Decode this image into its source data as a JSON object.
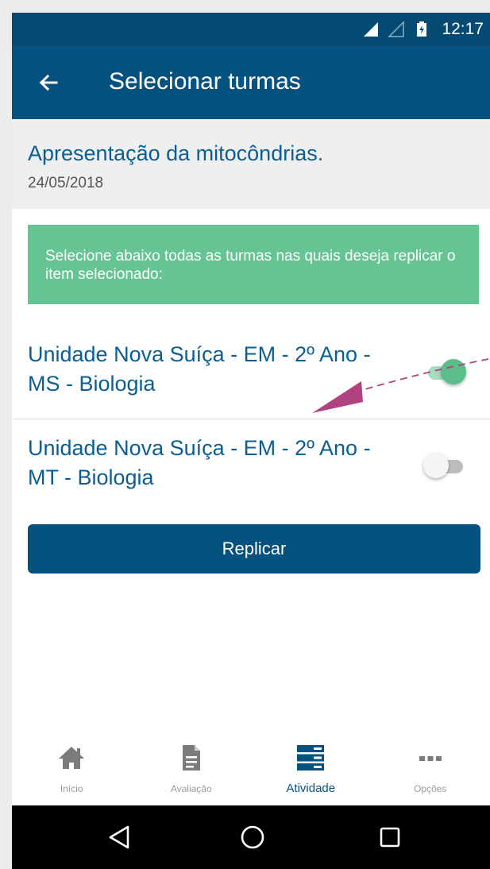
{
  "status_bar": {
    "time": "12:17"
  },
  "app_bar": {
    "title": "Selecionar turmas"
  },
  "activity": {
    "title": "Apresentação da mitocôndrias.",
    "date": "24/05/2018"
  },
  "info": {
    "message": "Selecione abaixo todas as turmas nas quais deseja replicar o item selecionado:"
  },
  "classes": [
    {
      "label": "Unidade Nova Suíça - EM   - 2º Ano - MS - Biologia",
      "selected": true
    },
    {
      "label": "Unidade Nova Suíça - EM   - 2º Ano - MT - Biologia",
      "selected": false
    }
  ],
  "replicate_button": {
    "label": "Replicar"
  },
  "bottom_nav": {
    "items": [
      {
        "label": "Início",
        "icon": "home-icon"
      },
      {
        "label": "Avaliação",
        "icon": "document-icon"
      },
      {
        "label": "Atividade",
        "icon": "activity-list-icon",
        "active": true
      },
      {
        "label": "Opções",
        "icon": "more-icon"
      }
    ]
  },
  "colors": {
    "primary": "#05517f",
    "accent_green": "#66c493",
    "annotation_arrow": "#b0437f"
  }
}
